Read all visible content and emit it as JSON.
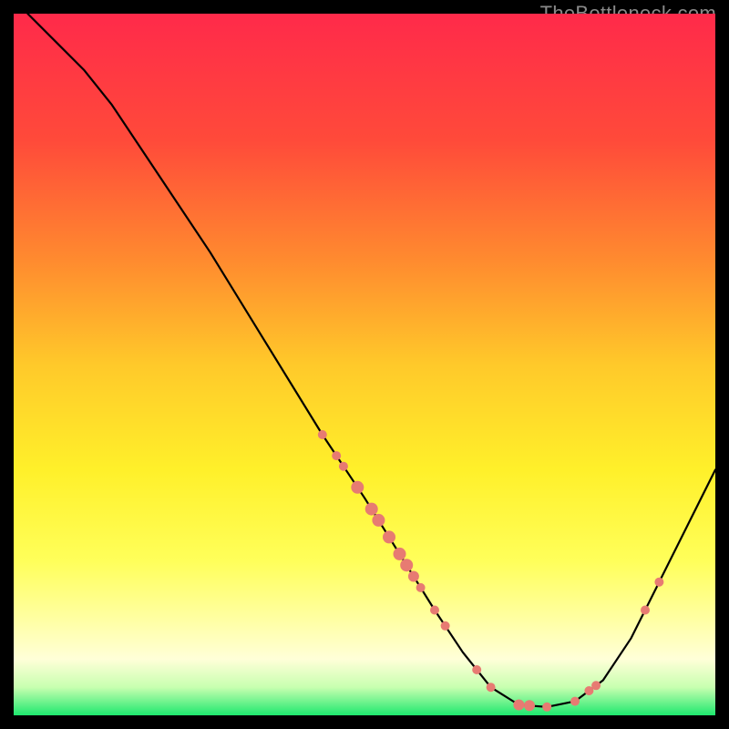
{
  "chart_data": {
    "type": "line",
    "watermark": "TheBottleneck.com",
    "xlim": [
      0,
      100
    ],
    "ylim": [
      0,
      100
    ],
    "gradient_stops": [
      {
        "offset": 0.0,
        "color": "#ff2a4a"
      },
      {
        "offset": 0.18,
        "color": "#ff4a3a"
      },
      {
        "offset": 0.35,
        "color": "#ff8a2f"
      },
      {
        "offset": 0.5,
        "color": "#ffc92a"
      },
      {
        "offset": 0.65,
        "color": "#fff02a"
      },
      {
        "offset": 0.78,
        "color": "#ffff5a"
      },
      {
        "offset": 0.86,
        "color": "#ffffa0"
      },
      {
        "offset": 0.92,
        "color": "#ffffd8"
      },
      {
        "offset": 0.96,
        "color": "#c8ffb0"
      },
      {
        "offset": 1.0,
        "color": "#1ee86e"
      }
    ],
    "curve": [
      {
        "x": 2,
        "y": 100
      },
      {
        "x": 6,
        "y": 96
      },
      {
        "x": 10,
        "y": 92
      },
      {
        "x": 14,
        "y": 87
      },
      {
        "x": 20,
        "y": 78
      },
      {
        "x": 28,
        "y": 66
      },
      {
        "x": 36,
        "y": 53
      },
      {
        "x": 44,
        "y": 40
      },
      {
        "x": 50,
        "y": 31
      },
      {
        "x": 55,
        "y": 23
      },
      {
        "x": 60,
        "y": 15
      },
      {
        "x": 64,
        "y": 9
      },
      {
        "x": 68,
        "y": 4
      },
      {
        "x": 72,
        "y": 1.5
      },
      {
        "x": 76,
        "y": 1.2
      },
      {
        "x": 80,
        "y": 2
      },
      {
        "x": 84,
        "y": 5
      },
      {
        "x": 88,
        "y": 11
      },
      {
        "x": 92,
        "y": 19
      },
      {
        "x": 96,
        "y": 27
      },
      {
        "x": 100,
        "y": 35
      }
    ],
    "marker_color": "#e77b72",
    "markers": [
      {
        "x": 44,
        "y": 40,
        "r": 5
      },
      {
        "x": 46,
        "y": 37,
        "r": 5
      },
      {
        "x": 47,
        "y": 35.5,
        "r": 5
      },
      {
        "x": 49,
        "y": 32.5,
        "r": 7
      },
      {
        "x": 51,
        "y": 29.5,
        "r": 7
      },
      {
        "x": 52,
        "y": 28,
        "r": 7
      },
      {
        "x": 53.5,
        "y": 25.5,
        "r": 7
      },
      {
        "x": 55,
        "y": 23,
        "r": 7
      },
      {
        "x": 56,
        "y": 21.5,
        "r": 7
      },
      {
        "x": 57,
        "y": 20,
        "r": 6
      },
      {
        "x": 58,
        "y": 18.5,
        "r": 5
      },
      {
        "x": 60,
        "y": 15,
        "r": 5
      },
      {
        "x": 61.5,
        "y": 12.5,
        "r": 5
      },
      {
        "x": 66,
        "y": 6,
        "r": 5
      },
      {
        "x": 68,
        "y": 4,
        "r": 5
      },
      {
        "x": 72,
        "y": 1.5,
        "r": 6
      },
      {
        "x": 73.5,
        "y": 1.3,
        "r": 6
      },
      {
        "x": 76,
        "y": 1.2,
        "r": 5
      },
      {
        "x": 80,
        "y": 2,
        "r": 5
      },
      {
        "x": 82,
        "y": 3.2,
        "r": 5
      },
      {
        "x": 83,
        "y": 4.2,
        "r": 5
      },
      {
        "x": 90,
        "y": 15,
        "r": 5
      },
      {
        "x": 92,
        "y": 19,
        "r": 5
      }
    ]
  }
}
